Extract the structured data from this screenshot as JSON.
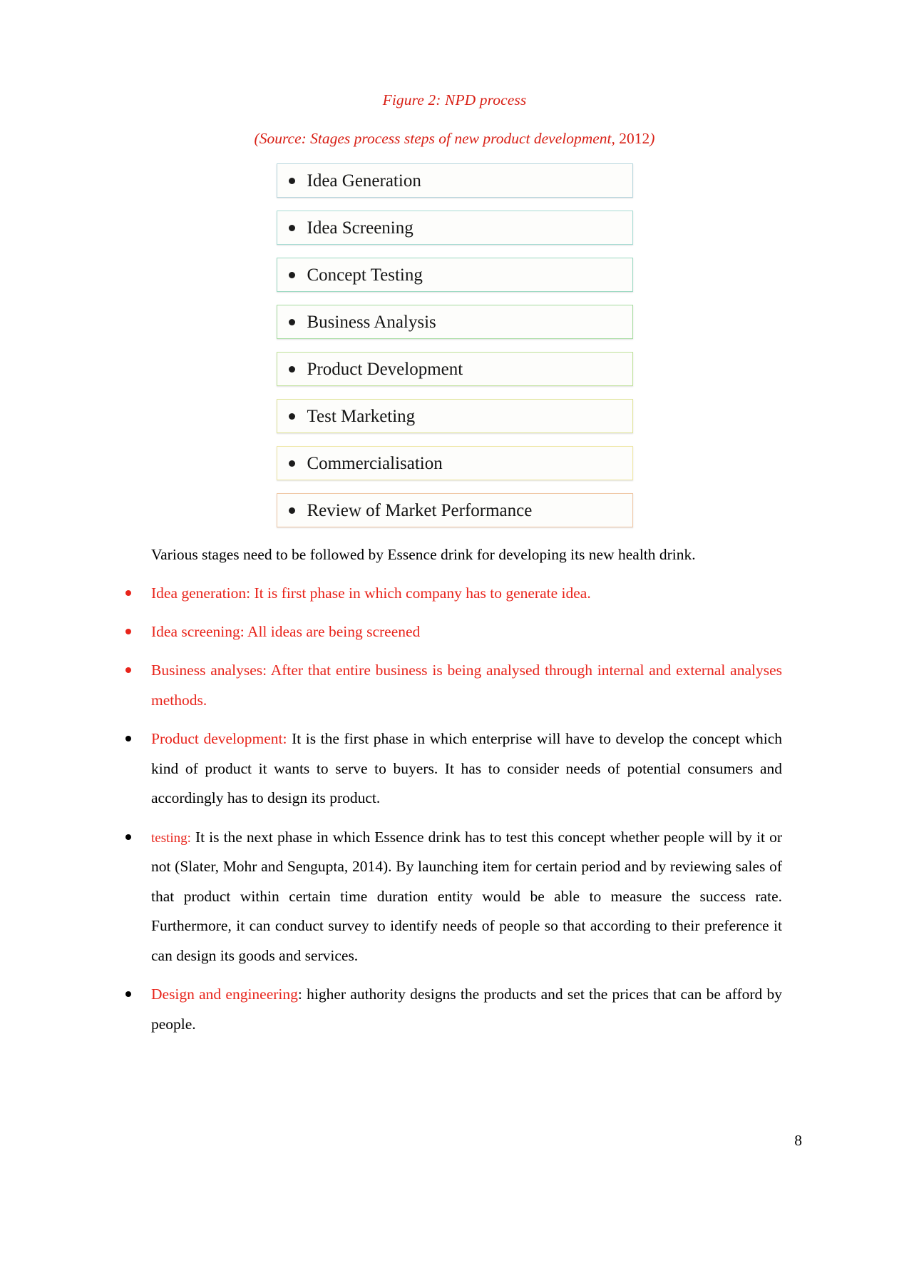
{
  "figure": {
    "caption": "Figure 2: NPD process",
    "source_prefix": "(Source: Stages process steps of new product development, ",
    "source_year": "2012",
    "source_suffix": ")",
    "caption_color": "#d81f15",
    "boxes": [
      {
        "label": "Idea Generation",
        "border_color": "#b7d6dd"
      },
      {
        "label": "Idea Screening",
        "border_color": "#a8dcd4"
      },
      {
        "label": "Concept Testing",
        "border_color": "#9cd9c2"
      },
      {
        "label": "Business Analysis",
        "border_color": "#a6dca0"
      },
      {
        "label": "Product Development",
        "border_color": "#bfe29a"
      },
      {
        "label": "Test Marketing",
        "border_color": "#e0e49a"
      },
      {
        "label": "Commercialisation",
        "border_color": "#efe6a4"
      },
      {
        "label": "Review of Market Performance",
        "border_color": "#f0c8a6"
      }
    ]
  },
  "body": {
    "intro": "Various stages need to be followed by Essence drink for developing its new health drink.",
    "bullets": [
      {
        "style": "all-red",
        "lead": "Idea generation:",
        "rest": " It is first phase in which company has to generate idea."
      },
      {
        "style": "all-red",
        "lead": "Idea screening:",
        "rest": " All ideas are being screened"
      },
      {
        "style": "all-red",
        "lead": "Business analyses:",
        "rest": " After that entire business is being analysed through internal and external analyses methods."
      },
      {
        "style": "red-lead",
        "lead": "Product development:",
        "rest": " It is the first phase in which enterprise will have to develop the concept which kind of product it wants to serve to buyers. It has to consider needs of potential consumers and accordingly has to design its product."
      },
      {
        "style": "red-lead-small",
        "lead": "testing:",
        "rest": " It is the next phase in which Essence drink has to test this concept whether people will by it or not (Slater, Mohr and Sengupta, 2014). By launching item for certain period and by reviewing sales of that product within certain time duration entity would be able to measure the success rate. Furthermore, it can conduct survey to identify needs of people so that according to their preference it can design its goods and services."
      },
      {
        "style": "red-lead-black-colon",
        "lead": "Design and engineering",
        "colon": ":",
        "rest": " higher authority designs the products and set the prices that can be afford by people."
      }
    ]
  },
  "footer": {
    "page_number": "8"
  }
}
